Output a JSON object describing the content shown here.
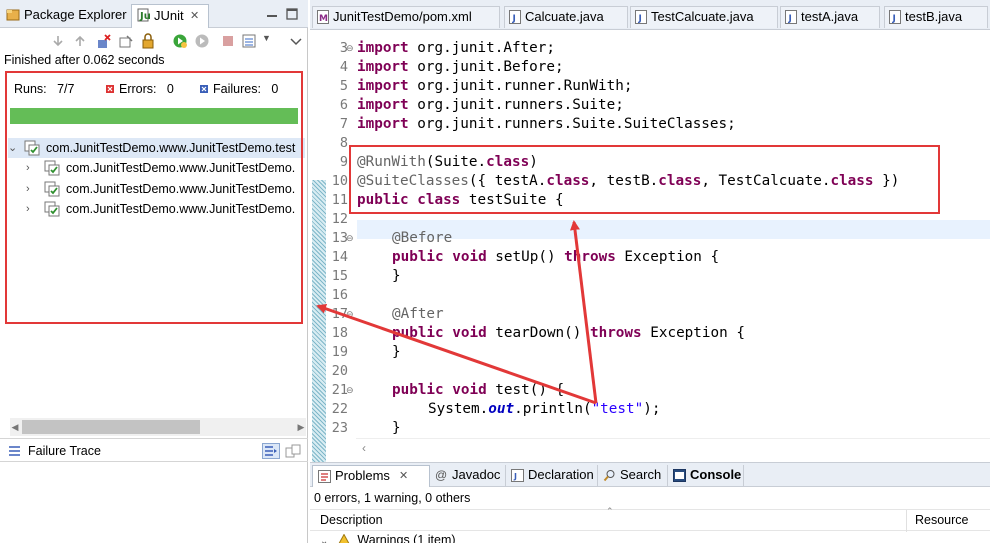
{
  "left_panel": {
    "tabs": [
      {
        "label": "Package Explorer",
        "icon": "package-explorer-icon"
      },
      {
        "label": "JUnit",
        "icon": "junit-icon",
        "close": "✕"
      }
    ],
    "status": "Finished after 0.062 seconds",
    "counters": {
      "runs_label": "Runs:",
      "runs_value": "7/7",
      "errors_label": "Errors:",
      "errors_value": "0",
      "failures_label": "Failures:",
      "failures_value": "0"
    },
    "progress_color": "#64bd57",
    "tree": [
      {
        "label": "com.JunitTestDemo.www.JunitTestDemo.test",
        "expanded": true
      },
      {
        "label": "com.JunitTestDemo.www.JunitTestDemo.",
        "expanded": false
      },
      {
        "label": "com.JunitTestDemo.www.JunitTestDemo.",
        "expanded": false
      },
      {
        "label": "com.JunitTestDemo.www.JunitTestDemo.",
        "expanded": false
      }
    ],
    "failure_trace_label": "Failure Trace"
  },
  "editor": {
    "tabs": [
      {
        "label": "JunitTestDemo/pom.xml",
        "icon": "maven-file-icon"
      },
      {
        "label": "Calcuate.java",
        "icon": "java-file-icon"
      },
      {
        "label": "TestCalcuate.java",
        "icon": "java-file-icon"
      },
      {
        "label": "testA.java",
        "icon": "java-file-icon"
      },
      {
        "label": "testB.java",
        "icon": "java-file-icon"
      }
    ],
    "line_numbers": [
      "3",
      "4",
      "5",
      "6",
      "7",
      "8",
      "9",
      "10",
      "11",
      "12",
      "13",
      "14",
      "15",
      "16",
      "17",
      "18",
      "19",
      "20",
      "21",
      "22",
      "23"
    ],
    "code": {
      "l3_kw": "import",
      "l3_rest": " org.junit.After;",
      "l4_kw": "import",
      "l4_rest": " org.junit.Before;",
      "l5_kw": "import",
      "l5_rest": " org.junit.runner.RunWith;",
      "l6_kw": "import",
      "l6_rest": " org.junit.runners.Suite;",
      "l7_kw": "import",
      "l7_rest": " org.junit.runners.Suite.SuiteClasses;",
      "l9_ann": "@RunWith",
      "l9_a": "(Suite.",
      "l9_kw": "class",
      "l9_b": ")",
      "l10_ann": "@SuiteClasses",
      "l10_a": "({ testA.",
      "l10_kw1": "class",
      "l10_b": ", testB.",
      "l10_kw2": "class",
      "l10_c": ", TestCalcuate.",
      "l10_kw3": "class",
      "l10_d": " })",
      "l11_kw": "public class",
      "l11_rest": " testSuite {",
      "l13_ann": "@Before",
      "l14_kw1": "public void",
      "l14_a": " setUp() ",
      "l14_kw2": "throws",
      "l14_b": " Exception {",
      "l15": "}",
      "l17_ann": "@After",
      "l18_kw1": "public void",
      "l18_a": " tearDown() ",
      "l18_kw2": "throws",
      "l18_b": " Exception {",
      "l19": "}",
      "l21_kw": "public void",
      "l21_rest": " test() {",
      "l22_a": "System.",
      "l22_fld": "out",
      "l22_b": ".println(",
      "l22_str": "\"test\"",
      "l22_c": ");",
      "l23": "}"
    }
  },
  "bottom_panel": {
    "tabs": [
      {
        "label": "Problems",
        "icon": "problems-icon",
        "close": "✕"
      },
      {
        "label": "Javadoc",
        "icon": "javadoc-icon"
      },
      {
        "label": "Declaration",
        "icon": "declaration-icon"
      },
      {
        "label": "Search",
        "icon": "search-icon"
      },
      {
        "label": "Console",
        "icon": "console-icon"
      }
    ],
    "summary": "0 errors, 1 warning, 0 others",
    "columns": [
      "Description",
      "Resource"
    ],
    "warning_row": "Warnings (1 item)"
  },
  "colors": {
    "highlight_box": "#e23838",
    "keyword": "#7f0055",
    "annotation": "#646464",
    "string": "#2a00ff"
  }
}
